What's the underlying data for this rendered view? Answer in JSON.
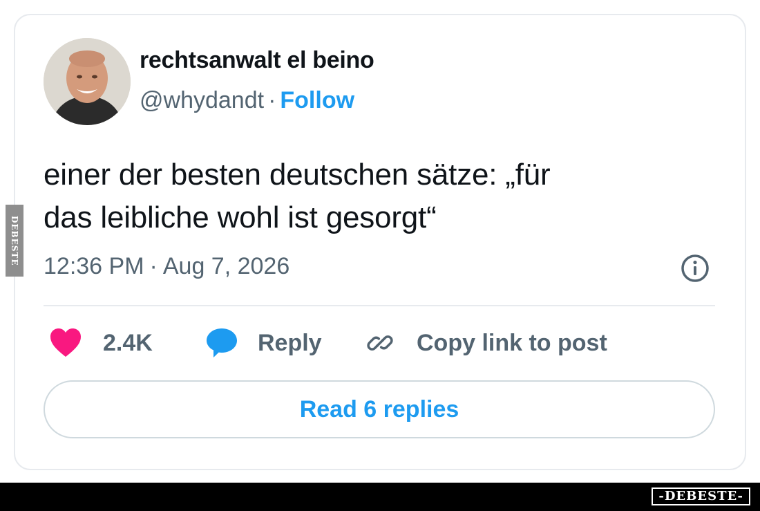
{
  "user": {
    "display_name": "rechtsanwalt el beino",
    "handle": "@whydandt",
    "separator": "·",
    "follow_label": "Follow"
  },
  "tweet": {
    "text_line1": "einer der besten deutschen sätze: „für",
    "text_line2": "das leibliche wohl ist gesorgt“",
    "time": "12:36 PM",
    "date": "Aug 7, 2026",
    "separator": "·"
  },
  "actions": {
    "like_count": "2.4K",
    "reply_label": "Reply",
    "copy_label": "Copy link to post"
  },
  "read_replies_label": "Read 6 replies",
  "watermark": {
    "side": "DEBESTE",
    "brand": "-DEBESTE-"
  },
  "colors": {
    "accent": "#1d9bf0",
    "like": "#f91880",
    "text": "#0f1419",
    "secondary": "#536471",
    "border": "#e7eaee"
  },
  "icons": [
    "avatar-photo",
    "info-icon",
    "heart-icon",
    "speech-bubble-icon",
    "link-icon"
  ]
}
